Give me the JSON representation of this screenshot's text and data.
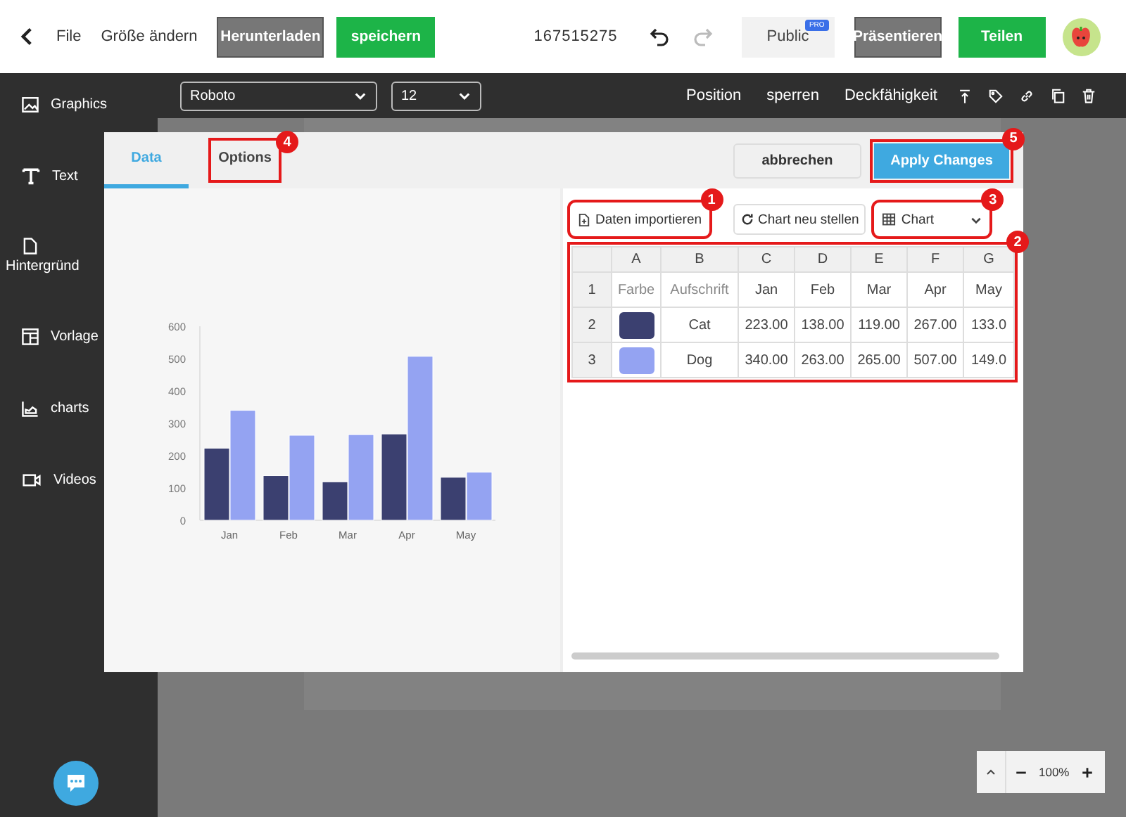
{
  "top_bar": {
    "menu": [
      "File",
      "Größe ändern"
    ],
    "buttons": [
      {
        "label": "Herunterladen",
        "kind": "gray"
      },
      {
        "label": "speichern",
        "kind": "green"
      }
    ],
    "doc_id": "167515275",
    "public": {
      "label": "Public",
      "badge": "PRO"
    },
    "right_buttons": [
      {
        "label": "Präsentieren",
        "kind": "gray"
      },
      {
        "label": "Teilen",
        "kind": "green"
      }
    ]
  },
  "sidebar": {
    "items": [
      {
        "label": "Graphics",
        "kind": "image"
      },
      {
        "label": "Text",
        "kind": "text"
      },
      {
        "label": "Hintergründ",
        "kind": "file"
      },
      {
        "label": "Vorlage",
        "kind": "layout"
      },
      {
        "label": "charts",
        "kind": "chart"
      },
      {
        "label": "Videos",
        "kind": "video"
      }
    ]
  },
  "toolbar": {
    "font": "Roboto",
    "size": "12",
    "actions": [
      "Position",
      "sperren",
      "Deckfähigkeit"
    ]
  },
  "dialog": {
    "tabs": [
      {
        "label": "Data",
        "selected": true
      },
      {
        "label": "Options",
        "selected": false,
        "annotation": "4"
      }
    ],
    "cancel": "abbrechen",
    "apply": {
      "label": "Apply Changes",
      "annotation": "5"
    },
    "import": {
      "label": "Daten importieren",
      "annotation": "1"
    },
    "rebuild": "Chart neu stellen",
    "chart_type": {
      "label": "Chart",
      "annotation": "3"
    },
    "sheet": {
      "annotation": "2",
      "columns": [
        "A",
        "B",
        "C",
        "D",
        "E",
        "F",
        "G"
      ],
      "rows": [
        {
          "number": "1",
          "cells": [
            {
              "kind": "header",
              "text": "Farbe"
            },
            {
              "kind": "header",
              "text": "Aufschrift"
            },
            {
              "kind": "text",
              "text": "Jan"
            },
            {
              "kind": "text",
              "text": "Feb"
            },
            {
              "kind": "text",
              "text": "Mar"
            },
            {
              "kind": "text",
              "text": "Apr"
            },
            {
              "kind": "text",
              "text": "May"
            }
          ]
        },
        {
          "number": "2",
          "cells": [
            {
              "kind": "swatch",
              "color": "#3b4070"
            },
            {
              "kind": "text",
              "text": "Cat"
            },
            {
              "kind": "text",
              "text": "223.00"
            },
            {
              "kind": "text",
              "text": "138.00"
            },
            {
              "kind": "text",
              "text": "119.00"
            },
            {
              "kind": "text",
              "text": "267.00"
            },
            {
              "kind": "text",
              "text": "133.0"
            }
          ]
        },
        {
          "number": "3",
          "cells": [
            {
              "kind": "swatch",
              "color": "#94a3f2"
            },
            {
              "kind": "text",
              "text": "Dog"
            },
            {
              "kind": "text",
              "text": "340.00"
            },
            {
              "kind": "text",
              "text": "263.00"
            },
            {
              "kind": "text",
              "text": "265.00"
            },
            {
              "kind": "text",
              "text": "507.00"
            },
            {
              "kind": "text",
              "text": "149.0"
            }
          ]
        }
      ]
    },
    "chart_data": {
      "type": "bar",
      "categories": [
        "Jan",
        "Feb",
        "Mar",
        "Apr",
        "May"
      ],
      "series": [
        {
          "color": "#3b4070",
          "values": [
            223,
            138,
            119,
            267,
            133
          ]
        },
        {
          "color": "#94a3f2",
          "values": [
            340,
            263,
            265,
            507,
            149
          ]
        }
      ],
      "ylim": [
        0,
        600
      ],
      "yticks": [
        0,
        100,
        200,
        300,
        400,
        500,
        600
      ]
    }
  },
  "zoom": {
    "level": "100%"
  }
}
